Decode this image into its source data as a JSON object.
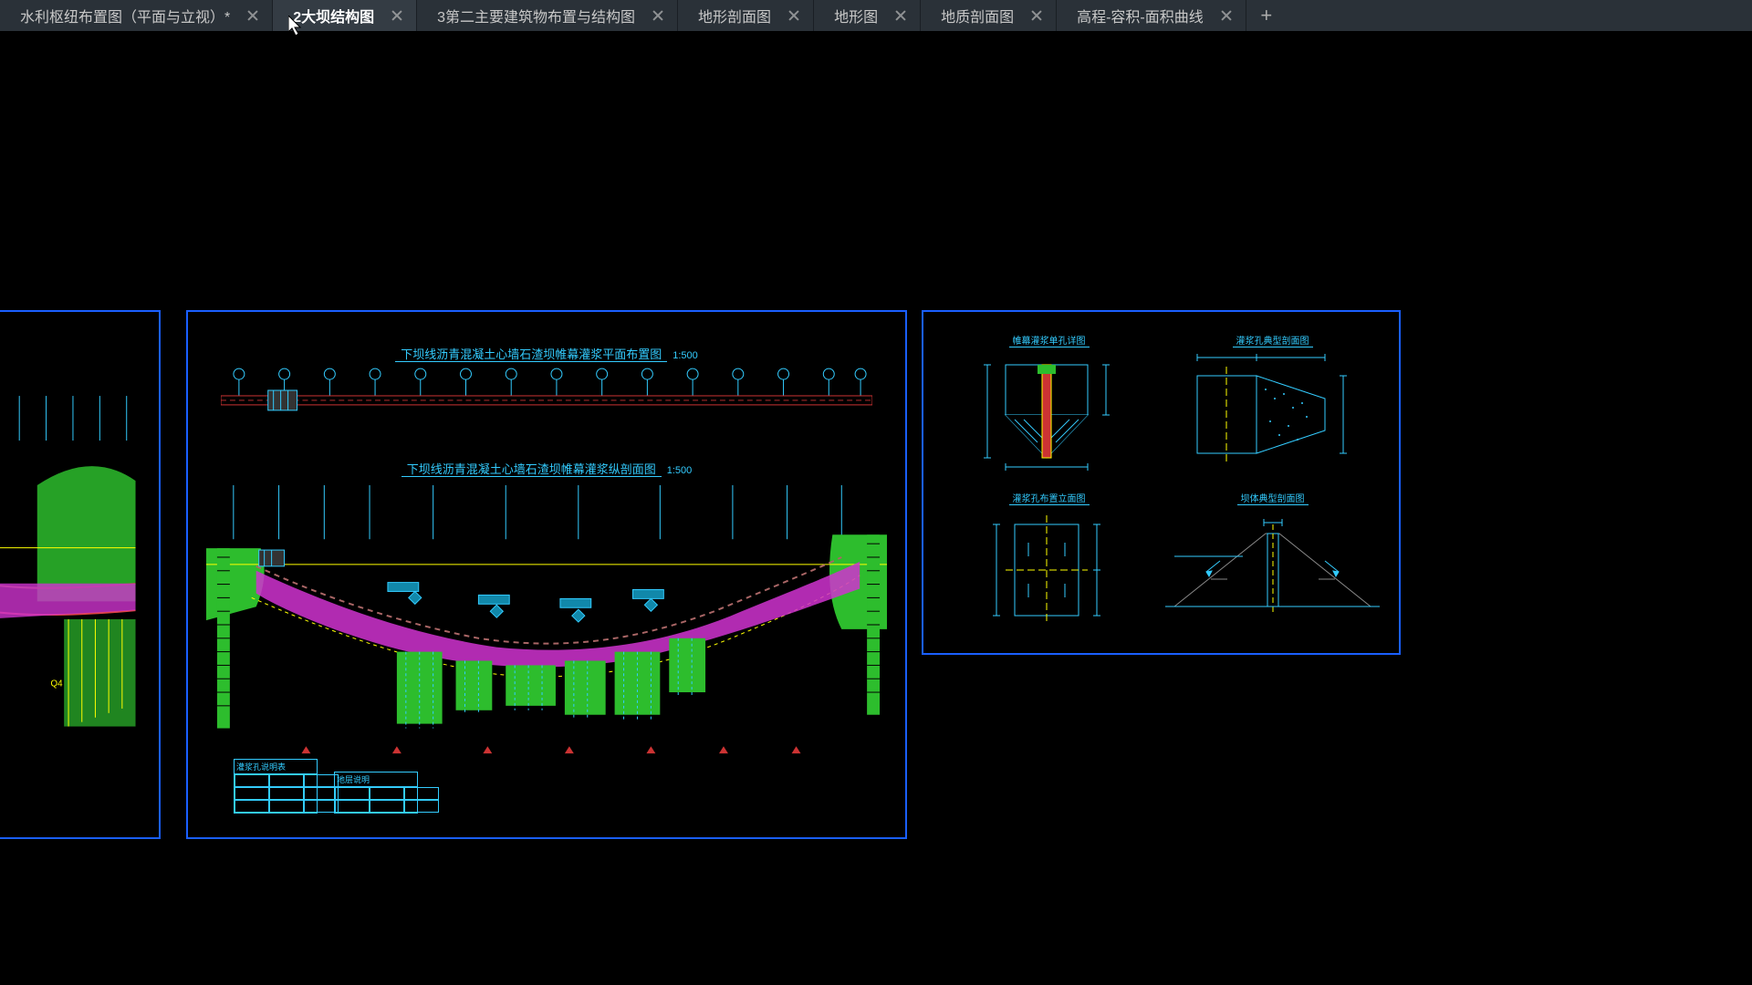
{
  "tabs": [
    {
      "label": "水利枢纽布置图（平面与立视）*",
      "active": false
    },
    {
      "label": "2大坝结构图",
      "active": true
    },
    {
      "label": "3第二主要建筑物布置与结构图",
      "active": false
    },
    {
      "label": "地形剖面图",
      "active": false
    },
    {
      "label": "地形图",
      "active": false
    },
    {
      "label": "地质剖面图",
      "active": false
    },
    {
      "label": "高程-容积-面积曲线",
      "active": false
    }
  ],
  "newtab_glyph": "+",
  "sheetB": {
    "title1": "下坝线沥青混凝土心墙石渣坝帷幕灌浆平面布置图",
    "scale1": "1:500",
    "title2": "下坝线沥青混凝土心墙石渣坝帷幕灌浆纵剖面图",
    "scale2": "1:500",
    "legend1_caption": "灌浆孔说明表",
    "legend2_caption": "地层说明"
  },
  "sheetC": {
    "cap1": "帷幕灌浆单孔详图",
    "cap2": "灌浆孔典型剖面图",
    "cap3": "灌浆孔布置立面图",
    "cap4": "坝体典型剖面图"
  }
}
